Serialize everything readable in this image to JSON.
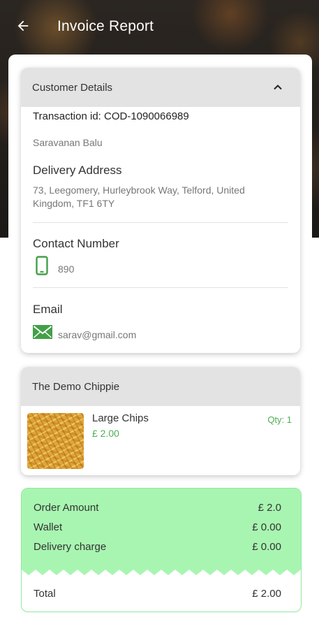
{
  "header": {
    "title": "Invoice Report"
  },
  "customer": {
    "section_title": "Customer Details",
    "transaction": "Transaction id: COD-1090066989",
    "name": "Saravanan Balu",
    "delivery_label": "Delivery Address",
    "delivery_line1": "73, Leegomery, Hurleybrook Way, Telford, United",
    "delivery_line2": "Kingdom, TF1 6TY",
    "contact_label": "Contact Number",
    "phone": "890",
    "email_label": "Email",
    "email": "sarav@gmail.com"
  },
  "order": {
    "restaurant": "The Demo Chippie",
    "items": [
      {
        "name": "Large Chips",
        "price": "£ 2.00",
        "qty": "Qty: 1"
      }
    ]
  },
  "summary": {
    "rows": [
      {
        "label": "Order Amount",
        "value": "£ 2.0"
      },
      {
        "label": "Wallet",
        "value": "£ 0.00"
      },
      {
        "label": "Delivery charge",
        "value": "£ 0.00"
      }
    ],
    "total_label": "Total",
    "total_value": "£ 2.00"
  },
  "colors": {
    "accent_green": "#4caf50",
    "summary_bg": "#a8f5b1",
    "header_bg": "#e3e3e3"
  },
  "icons": [
    "back-arrow-icon",
    "chevron-up-icon",
    "phone-icon",
    "mail-icon"
  ]
}
